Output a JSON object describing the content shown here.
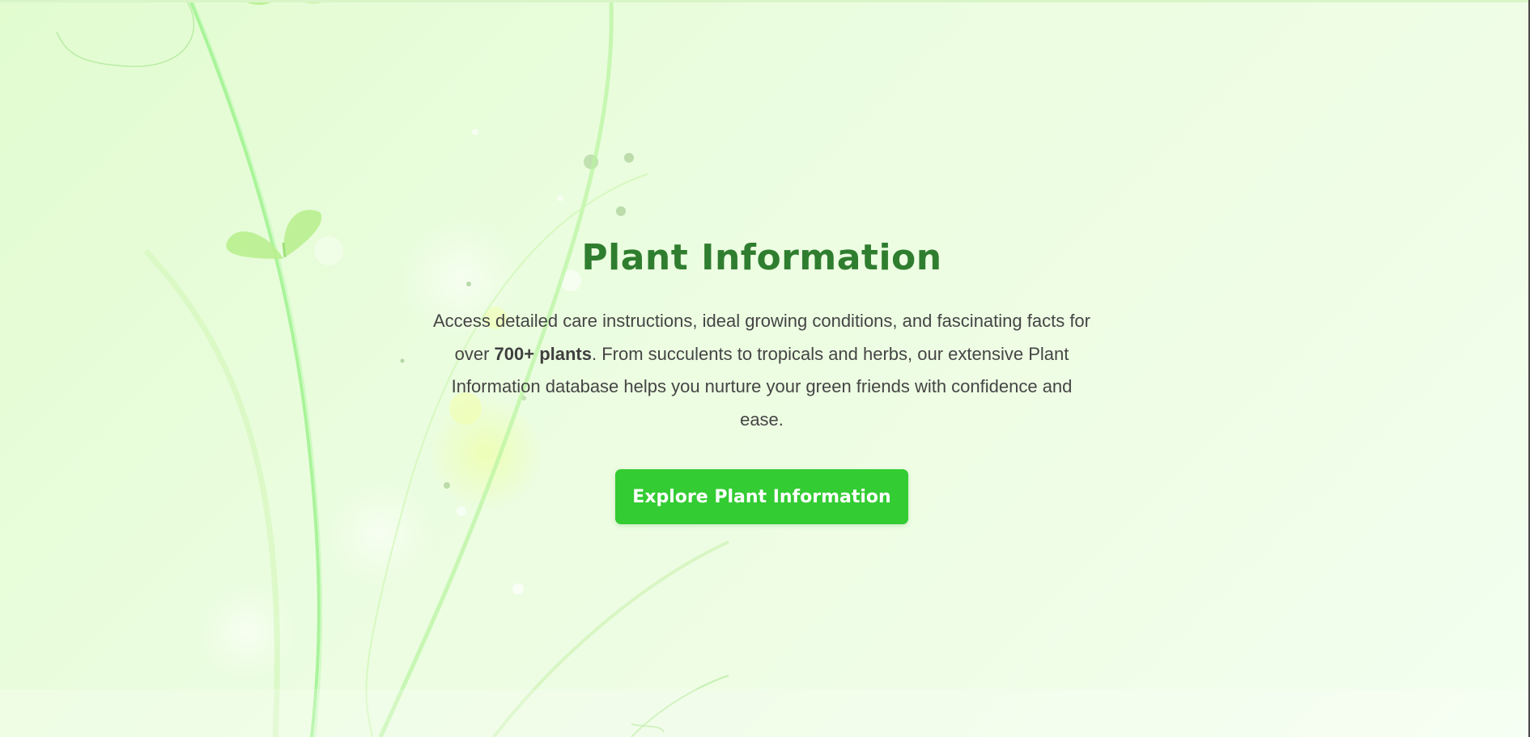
{
  "hero": {
    "title": "Plant Information",
    "description_before": "Access detailed care instructions, ideal growing conditions, and fascinating facts for over ",
    "description_highlight": "700+ plants",
    "description_after": ". From succulents to tropicals and herbs, our extensive Plant Information database helps you nurture your green friends with confidence and ease.",
    "button_label": "Explore Plant Information"
  },
  "colors": {
    "title": "#2f7d2f",
    "button": "#33cc33",
    "button_text": "#ffffff",
    "body_text": "#454545",
    "background": "#e9fddd"
  },
  "icons": {
    "background_art": "vine-leaf-illustration"
  }
}
